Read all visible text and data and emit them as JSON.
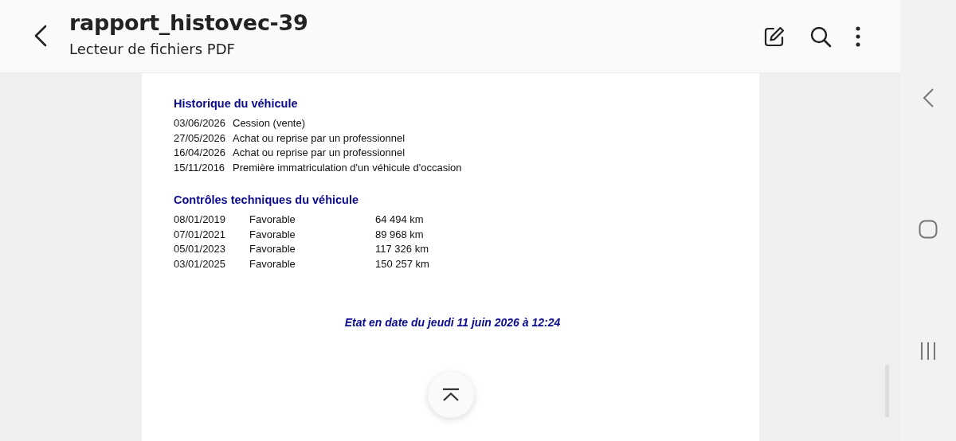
{
  "header": {
    "title": "rapport_histovec-39",
    "subtitle": "Lecteur de fichiers PDF"
  },
  "document": {
    "sections": [
      {
        "kind": "history",
        "heading": "Historique du véhicule",
        "rows": [
          {
            "date": "03/06/2026",
            "event": "Cession (vente)"
          },
          {
            "date": "27/05/2026",
            "event": "Achat ou reprise par un professionnel"
          },
          {
            "date": "16/04/2026",
            "event": "Achat ou reprise par un professionnel"
          },
          {
            "date": "15/11/2016",
            "event": "Première immatriculation d'un véhicule d'occasion"
          }
        ]
      },
      {
        "kind": "inspections",
        "heading": "Contrôles techniques du véhicule",
        "rows": [
          {
            "date": "08/01/2019",
            "result": "Favorable",
            "mileage": "64 494 km"
          },
          {
            "date": "07/01/2021",
            "result": "Favorable",
            "mileage": "89 968 km"
          },
          {
            "date": "05/01/2023",
            "result": "Favorable",
            "mileage": "117 326 km"
          },
          {
            "date": "03/01/2025",
            "result": "Favorable",
            "mileage": "150 257 km"
          }
        ]
      }
    ],
    "footer": "Etat en date du jeudi 11 juin 2026 à 12:24"
  }
}
